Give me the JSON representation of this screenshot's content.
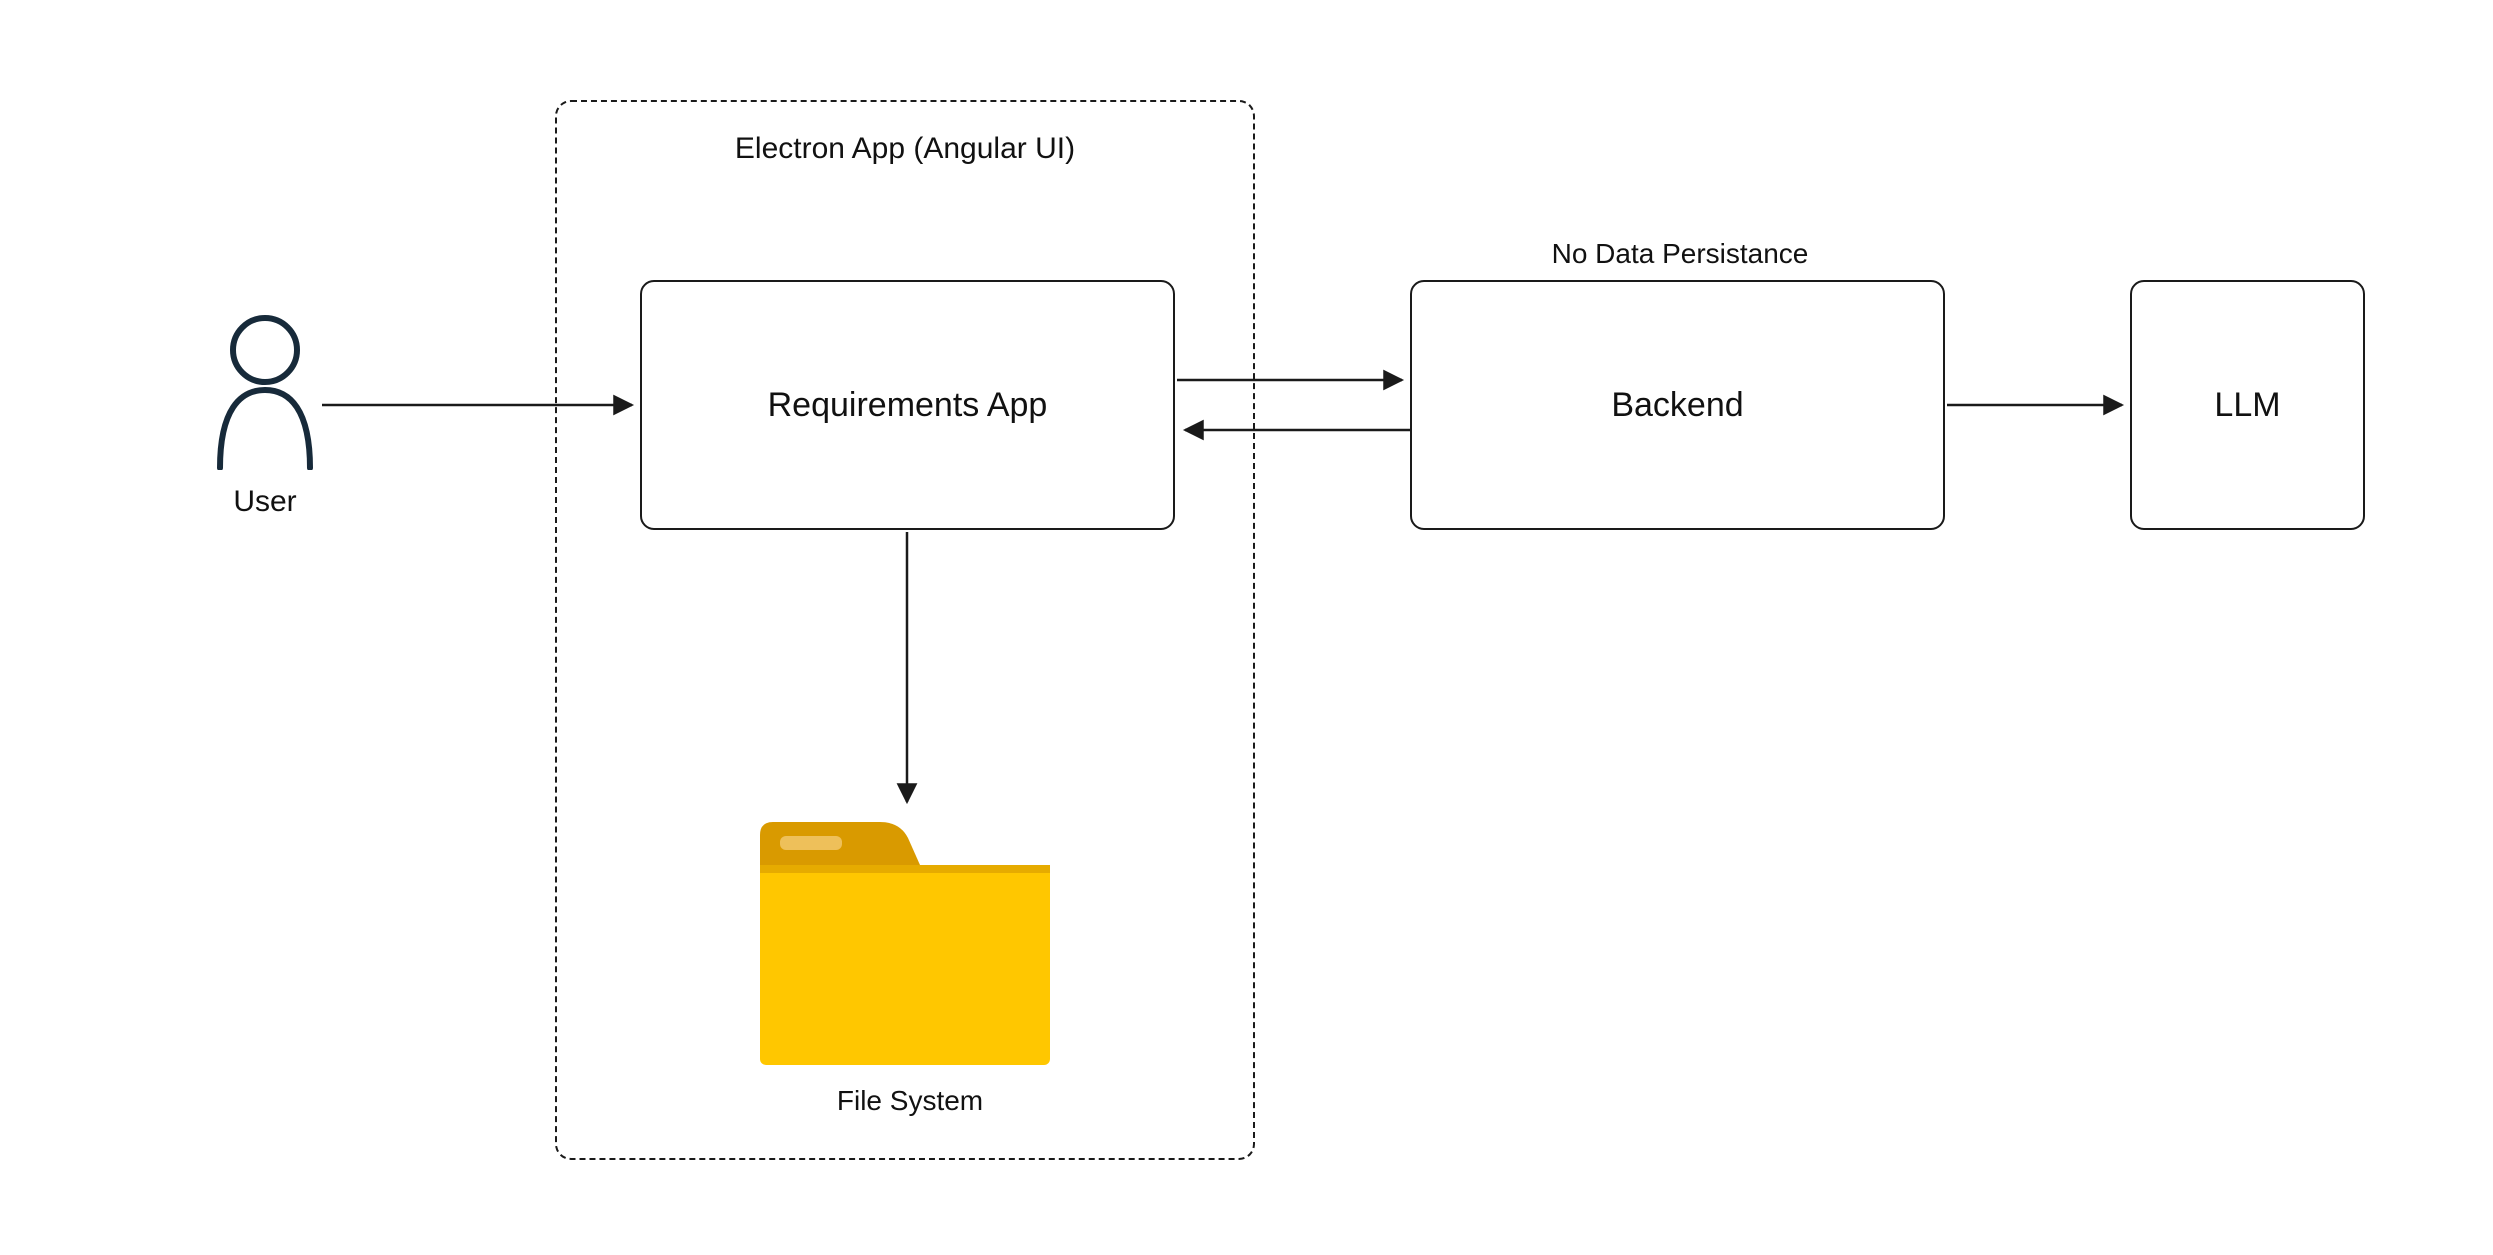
{
  "user": {
    "label": "User"
  },
  "container": {
    "title": "Electron App (Angular UI)"
  },
  "nodes": {
    "requirements_app": {
      "label": "Requirements App"
    },
    "backend": {
      "label": "Backend",
      "annotation": "No Data Persistance"
    },
    "llm": {
      "label": "LLM"
    },
    "filesystem": {
      "label": "File System"
    }
  },
  "colors": {
    "stroke": "#1a1a1a",
    "folder_dark": "#d99a00",
    "folder_light": "#ffc700"
  }
}
